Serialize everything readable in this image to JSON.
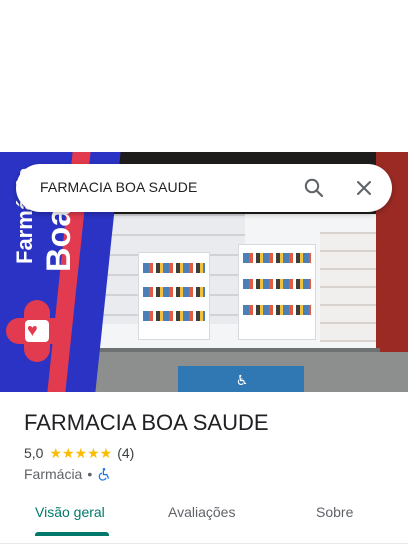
{
  "search": {
    "query": "FARMACIA BOA SAUDE",
    "search_icon": "search-icon",
    "close_icon": "close-icon"
  },
  "photo": {
    "banner_text_small": "Farmácia",
    "banner_text_large": "Boa",
    "colors": {
      "banner_blue": "#2a33c4",
      "banner_red": "#e23a4e",
      "parking_blue": "#2f78b3"
    }
  },
  "place": {
    "title": "FARMACIA BOA SAUDE",
    "rating": "5,0",
    "stars": "★★★★★",
    "review_count": "(4)",
    "rating_value": 5.0,
    "category": "Farmácia",
    "separator": "•",
    "accessibility_icon": "wheelchair-icon"
  },
  "tabs": [
    {
      "label": "Visão geral",
      "active": true
    },
    {
      "label": "Avaliações",
      "active": false
    },
    {
      "label": "Sobre",
      "active": false
    }
  ],
  "colors": {
    "accent": "#00796b",
    "star": "#fbbc04",
    "text": "#202124",
    "secondary": "#5f6368"
  }
}
